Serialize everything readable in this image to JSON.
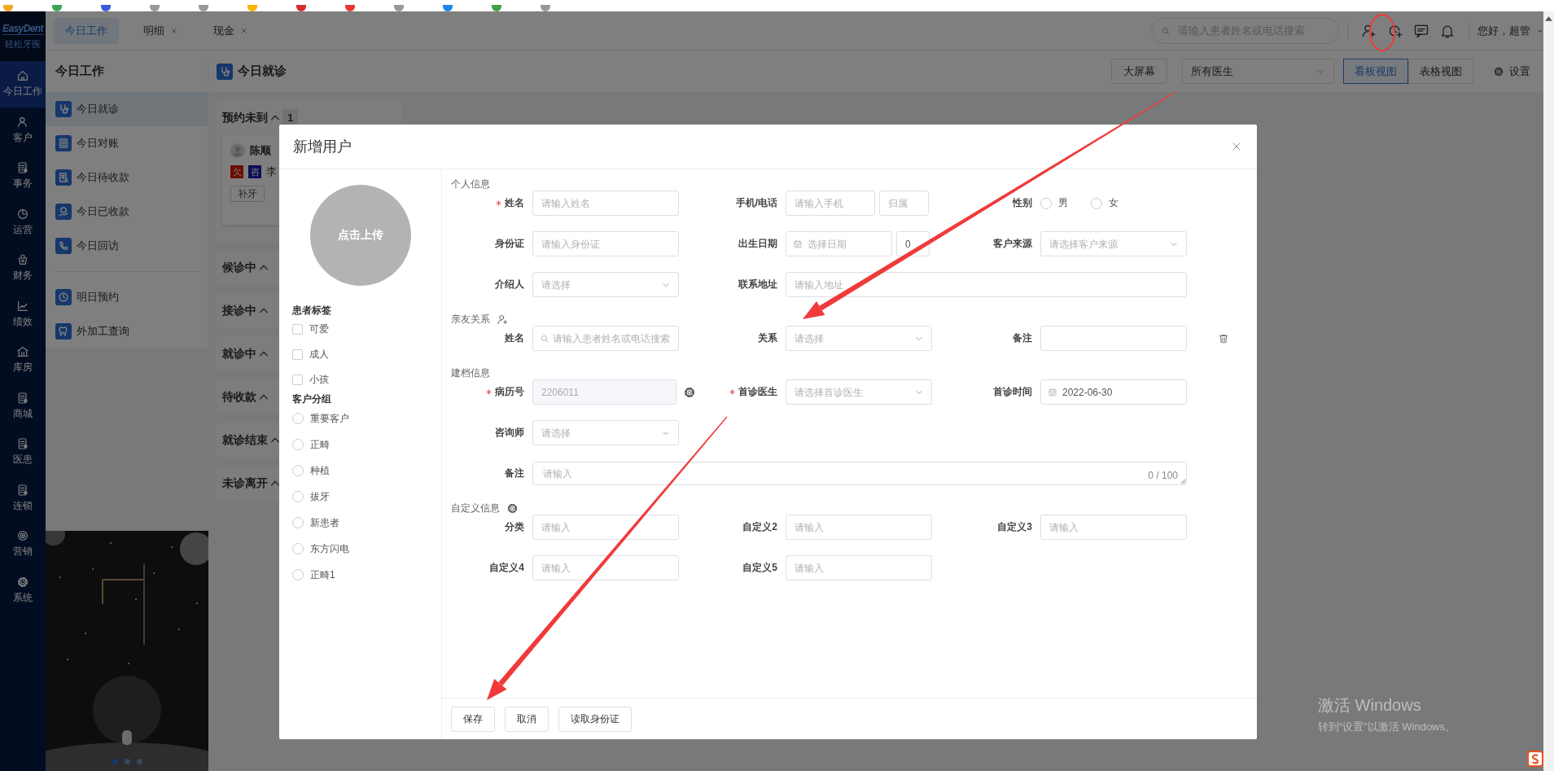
{
  "header": {
    "logo": {
      "brand": "EasyDent",
      "subtitle": "轻松牙医"
    },
    "tabs": [
      {
        "label": "今日工作",
        "selected": true,
        "closable": false
      },
      {
        "label": "明细",
        "selected": false,
        "closable": true
      },
      {
        "label": "现金",
        "selected": false,
        "closable": true
      }
    ],
    "search": {
      "placeholder": "请输入患者姓名或电话搜索"
    },
    "greeting": "您好，超管"
  },
  "nav": [
    {
      "label": "今日工作",
      "selected": true
    },
    {
      "label": "客户",
      "selected": false
    },
    {
      "label": "事务",
      "selected": false
    },
    {
      "label": "运营",
      "selected": false
    },
    {
      "label": "财务",
      "selected": false
    },
    {
      "label": "绩效",
      "selected": false
    },
    {
      "label": "库房",
      "selected": false
    },
    {
      "label": "商城",
      "selected": false
    },
    {
      "label": "医患",
      "selected": false
    },
    {
      "label": "连锁",
      "selected": false
    },
    {
      "label": "营销",
      "selected": false
    },
    {
      "label": "系统",
      "selected": false
    }
  ],
  "sidebar": {
    "title": "今日工作",
    "groups": [
      [
        {
          "label": "今日就诊",
          "selected": true
        },
        {
          "label": "今日对账",
          "selected": false
        },
        {
          "label": "今日待收款",
          "selected": false
        },
        {
          "label": "今日已收款",
          "selected": false
        },
        {
          "label": "今日回访",
          "selected": false
        }
      ],
      [
        {
          "label": "明日预约",
          "selected": false
        },
        {
          "label": "外加工查询",
          "selected": false
        }
      ]
    ]
  },
  "poster": {
    "kind": "picture",
    "dots": [
      {
        "selected": true
      },
      {
        "selected": false
      },
      {
        "selected": false
      }
    ]
  },
  "main": {
    "title": "今日就诊",
    "toolbar": {
      "big_screen": "大屏幕",
      "doctor_select": "所有医生",
      "views": [
        {
          "label": "看板视图",
          "selected": true
        },
        {
          "label": "表格视图",
          "selected": false
        }
      ],
      "settings": "设置"
    },
    "lanes": [
      {
        "title": "预约未到",
        "expanded": true,
        "count": "1",
        "cards": [
          {
            "name": "陈顺",
            "tags": [
              {
                "text": "欠",
                "color": "#6c0f03"
              },
              {
                "text": "咨",
                "color": "#0e0e58"
              }
            ],
            "doctor": "李",
            "button": "补牙"
          }
        ]
      },
      {
        "title": "候诊中",
        "expanded": true
      },
      {
        "title": "接诊中",
        "expanded": true
      },
      {
        "title": "就诊中",
        "expanded": true
      },
      {
        "title": "待收款",
        "expanded": true
      },
      {
        "title": "就诊结束",
        "expanded": true
      },
      {
        "title": "未诊离开",
        "expanded": true
      }
    ]
  },
  "modal": {
    "title": "新增用户",
    "avatar_upload": "点击上传",
    "tag_groups": [
      {
        "title": "患者标签",
        "kind": "checkbox",
        "options": [
          {
            "label": "可爱",
            "checked": false
          },
          {
            "label": "成人",
            "checked": false
          },
          {
            "label": "小孩",
            "checked": false
          }
        ]
      },
      {
        "title": "客户分组",
        "kind": "radio",
        "options": [
          {
            "label": "重要客户",
            "selected": false
          },
          {
            "label": "正畸",
            "selected": false
          },
          {
            "label": "种植",
            "selected": false
          },
          {
            "label": "拔牙",
            "selected": false
          },
          {
            "label": "新患者",
            "selected": false
          },
          {
            "label": "东方闪电",
            "selected": false
          },
          {
            "label": "正畸1",
            "selected": false
          }
        ]
      }
    ],
    "sections": [
      {
        "title": "个人信息",
        "rows": [
          {
            "fields": [
              {
                "label": "姓名",
                "required": true,
                "kind": "input",
                "placeholder": "请输入姓名"
              },
              {
                "label": "手机/电话",
                "kind": "phone",
                "placeholder": "请输入手机",
                "extra_placeholder": "归属"
              },
              {
                "label": "性别",
                "kind": "radio",
                "options": [
                  {
                    "label": "男",
                    "selected": false
                  },
                  {
                    "label": "女",
                    "selected": false
                  }
                ]
              }
            ]
          },
          {
            "fields": [
              {
                "label": "身份证",
                "kind": "input",
                "placeholder": "请输入身份证"
              },
              {
                "label": "出生日期",
                "kind": "date_age",
                "placeholder": "选择日期",
                "age": "0"
              },
              {
                "label": "客户来源",
                "kind": "select",
                "placeholder": "请选择客户来源"
              }
            ]
          },
          {
            "fields": [
              {
                "label": "介绍人",
                "kind": "select",
                "placeholder": "请选择"
              },
              {
                "label": "联系地址",
                "kind": "long_input",
                "placeholder": "请输入地址"
              }
            ]
          }
        ]
      },
      {
        "title": "亲友关系",
        "addable": true,
        "rows": [
          {
            "removable": true,
            "fields": [
              {
                "label": "姓名",
                "kind": "search",
                "placeholder": "请输入患者姓名或电话搜索"
              },
              {
                "label": "关系",
                "kind": "select",
                "placeholder": "请选择"
              },
              {
                "label": "备注",
                "kind": "input"
              }
            ]
          }
        ]
      },
      {
        "title": "建档信息",
        "rows": [
          {
            "fields": [
              {
                "label": "病历号",
                "required": true,
                "kind": "input",
                "value": "2206011",
                "disabled": true,
                "configurable": true
              },
              {
                "label": "首诊医生",
                "required": true,
                "kind": "select",
                "placeholder": "请选择首诊医生"
              },
              {
                "label": "首诊时间",
                "kind": "date",
                "value": "2022-06-30"
              }
            ]
          },
          {
            "fields": [
              {
                "label": "咨询师",
                "kind": "select",
                "placeholder": "请选择"
              }
            ]
          },
          {
            "fields": [
              {
                "label": "备注",
                "kind": "textarea",
                "placeholder": "请输入",
                "counter": "0 / 100"
              }
            ]
          }
        ]
      },
      {
        "title": "自定义信息",
        "configurable": true,
        "rows": [
          {
            "fields": [
              {
                "label": "分类",
                "kind": "input",
                "placeholder": "请输入"
              },
              {
                "label": "自定义2",
                "kind": "input",
                "placeholder": "请输入"
              },
              {
                "label": "自定义3",
                "kind": "input",
                "placeholder": "请输入"
              }
            ]
          },
          {
            "fields": [
              {
                "label": "自定义4",
                "kind": "input",
                "placeholder": "请输入"
              },
              {
                "label": "自定义5",
                "kind": "input",
                "placeholder": "请输入"
              }
            ]
          }
        ]
      }
    ],
    "buttons": [
      "保存",
      "取消",
      "读取身份证"
    ]
  },
  "annotations": [
    {
      "kind": "ellipse"
    },
    {
      "kind": "arrow"
    },
    {
      "kind": "arrow"
    }
  ],
  "system_notice": {
    "title": "激活 Windows",
    "text": "转到“设置”以激活 Windows。"
  }
}
